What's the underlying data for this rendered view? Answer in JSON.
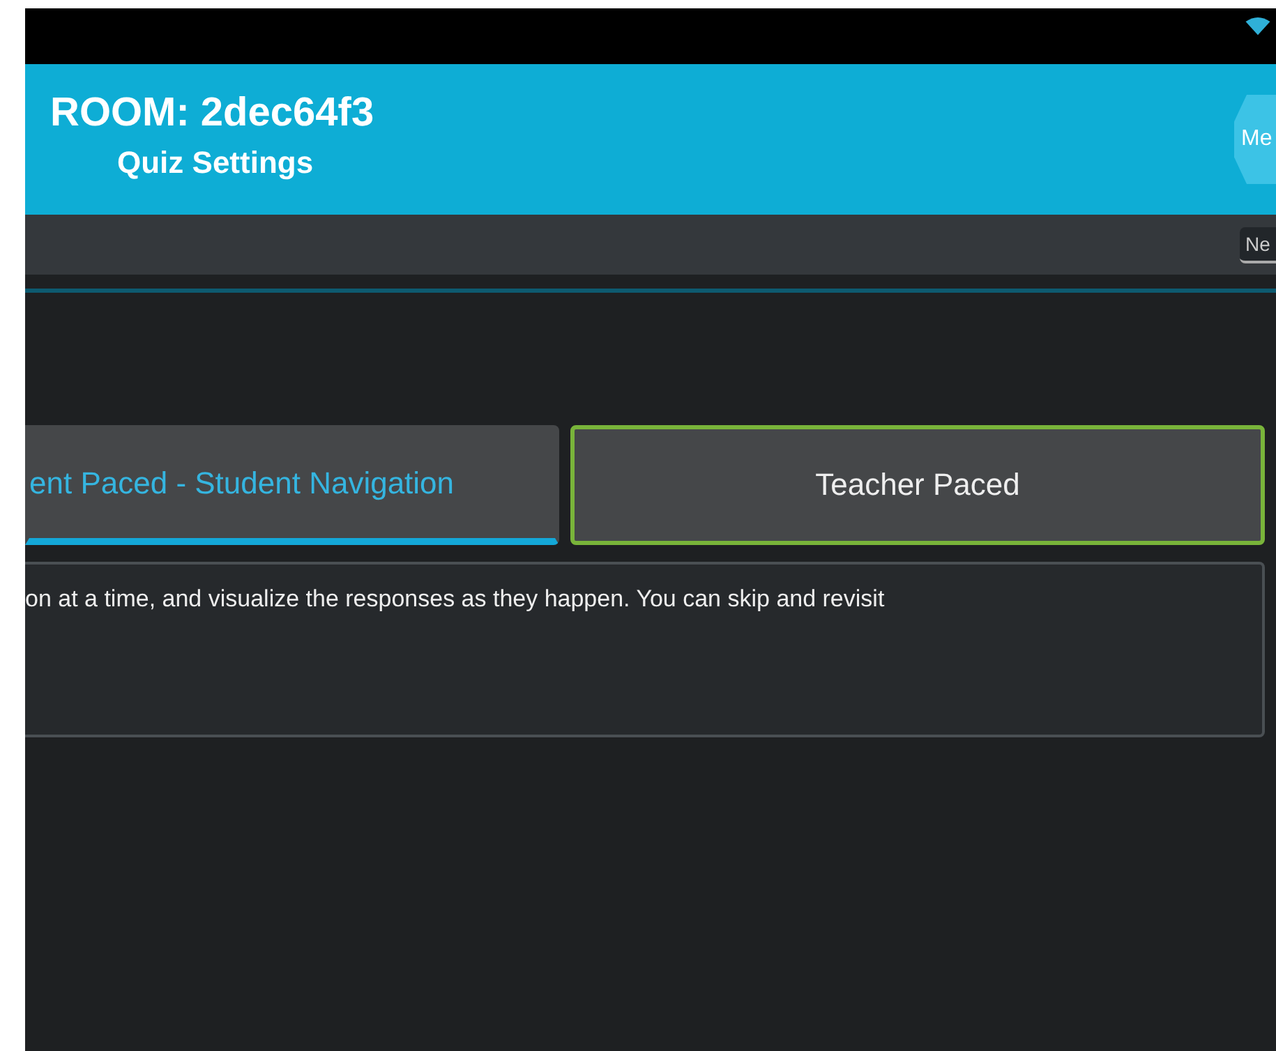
{
  "header": {
    "room_title": "ROOM: 2dec64f3",
    "subtitle": "Quiz Settings",
    "menu_button": "Me"
  },
  "toolbar": {
    "field_value": "Ne"
  },
  "pace_tabs": [
    {
      "label": "ent Paced - Student Navigation",
      "selected": false,
      "focused": true
    },
    {
      "label": "Teacher Paced",
      "selected": true,
      "focused": false
    }
  ],
  "description": "on at a time, and visualize the responses as they happen. You can skip and revisit"
}
